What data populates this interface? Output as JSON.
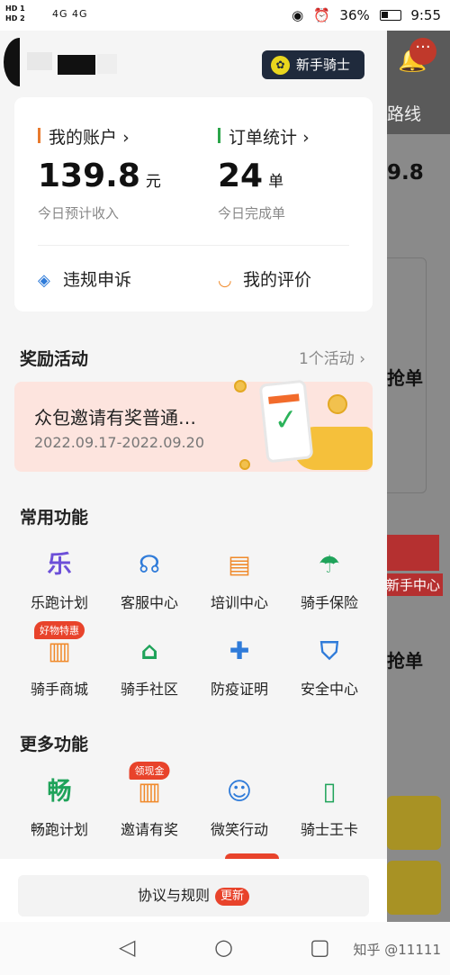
{
  "status_bar": {
    "sim1": "HD 1",
    "sim2": "HD 2",
    "network": "4G 4G",
    "battery": "36%",
    "time": "9:55"
  },
  "background": {
    "route_label": "路线",
    "amount": "9.8",
    "grab_order_1": "抢单",
    "newbie_center": "新手中心",
    "grab_order_2": "抢单",
    "notification_dots": "···"
  },
  "header": {
    "rider_badge": "新手骑士"
  },
  "account": {
    "my_account_label": "我的账户",
    "income_value": "139.8",
    "income_unit": "元",
    "income_sub": "今日预计收入",
    "order_stats_label": "订单统计",
    "orders_value": "24",
    "orders_unit": "单",
    "orders_sub": "今日完成单",
    "appeal_label": "违规申诉",
    "reviews_label": "我的评价"
  },
  "rewards": {
    "title": "奖励活动",
    "count": "1个活动",
    "promo_title": "众包邀请有奖普通…",
    "promo_dates": "2022.09.17-2022.09.20"
  },
  "common": {
    "title": "常用功能",
    "items": [
      {
        "label": "乐跑计划",
        "icon": "乐",
        "color": "#6c4fd8"
      },
      {
        "label": "客服中心",
        "icon": "headset-icon",
        "color": "#2f7bd9"
      },
      {
        "label": "培训中心",
        "icon": "folder-icon",
        "color": "#f08a2b"
      },
      {
        "label": "骑手保险",
        "icon": "umbrella-icon",
        "color": "#1fa35a"
      },
      {
        "label": "骑手商城",
        "icon": "shirt-icon",
        "color": "#f08a2b",
        "tag": "好物特惠"
      },
      {
        "label": "骑手社区",
        "icon": "house-icon",
        "color": "#1fa35a"
      },
      {
        "label": "防疫证明",
        "icon": "medical-icon",
        "color": "#2f7bd9"
      },
      {
        "label": "安全中心",
        "icon": "shield-icon",
        "color": "#2f7bd9"
      }
    ]
  },
  "more": {
    "title": "更多功能",
    "items": [
      {
        "label": "畅跑计划",
        "icon": "畅",
        "color": "#1fa35a"
      },
      {
        "label": "邀请有奖",
        "icon": "shirt-icon",
        "color": "#f08a2b",
        "tag": "领现金"
      },
      {
        "label": "微笑行动",
        "icon": "smile-icon",
        "color": "#2f7bd9"
      },
      {
        "label": "骑士王卡",
        "icon": "card-icon",
        "color": "#1fa35a"
      }
    ]
  },
  "footer": {
    "rules_label": "协议与规则",
    "new_badge": "更新"
  },
  "watermark": "知乎 @11111"
}
